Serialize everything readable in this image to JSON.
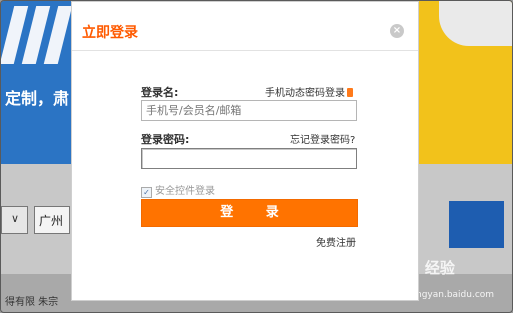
{
  "background": {
    "slogan": "定制，肃",
    "city": "广州",
    "footer": "得有限    朱宗",
    "watermark": "Bai 经验",
    "watermark_url": "jingyan.baidu.com"
  },
  "dialog": {
    "title": "立即登录",
    "close_symbol": "×",
    "username_label": "登录名:",
    "phone_login_link": "手机动态密码登录",
    "username_placeholder": "手机号/会员名/邮箱",
    "password_label": "登录密码:",
    "forgot_password_link": "忘记登录密码?",
    "password_value": "",
    "security_checkbox_label": "安全控件登录",
    "security_checked": true,
    "login_button": "登 录",
    "register_link": "免费注册"
  },
  "colors": {
    "accent": "#ff7300",
    "title": "#ff5a00"
  }
}
